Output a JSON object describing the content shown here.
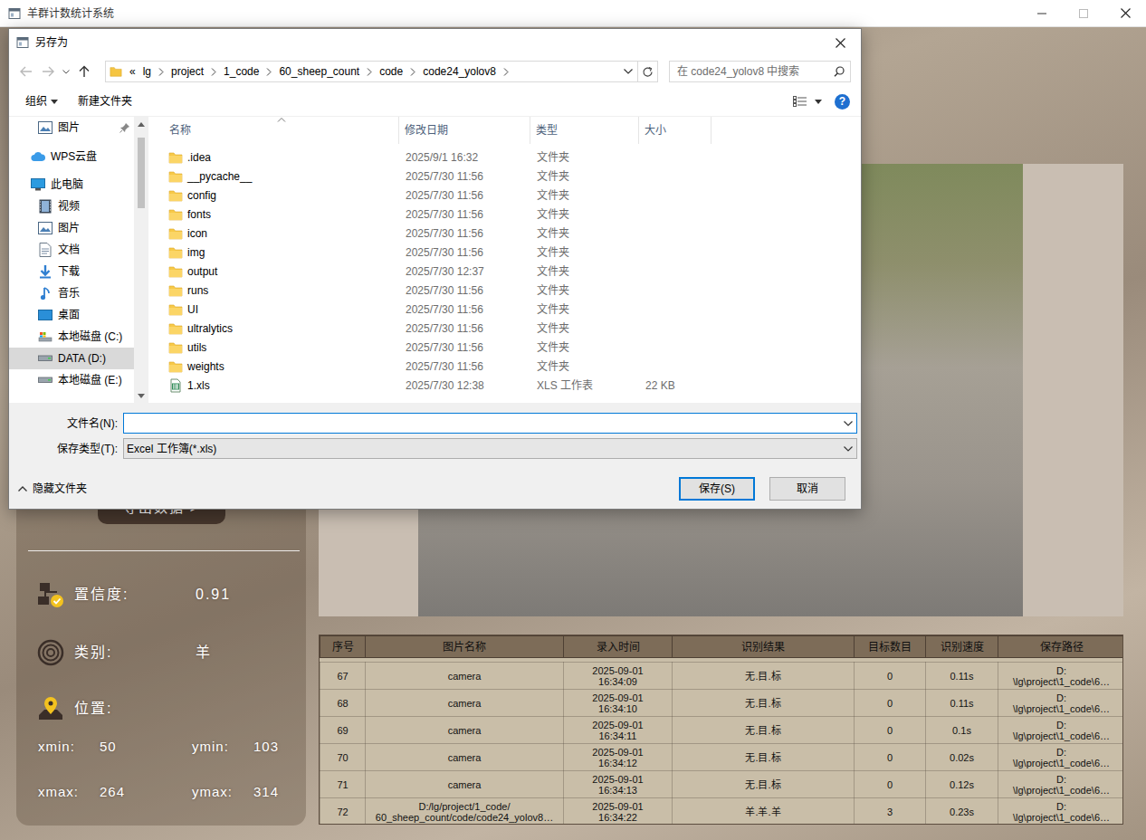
{
  "window": {
    "title": "羊群计数统计系统"
  },
  "side_panel": {
    "export_button": "导出数据 >",
    "confidence": {
      "label": "置信度:",
      "value": "0.91"
    },
    "category": {
      "label": "类别:",
      "value": "羊"
    },
    "position": {
      "label": "位置:",
      "coords": [
        {
          "label": "xmin:",
          "value": "50"
        },
        {
          "label": "ymin:",
          "value": "103"
        },
        {
          "label": "xmax:",
          "value": "264"
        },
        {
          "label": "ymax:",
          "value": "314"
        }
      ]
    }
  },
  "table": {
    "columns": [
      "序号",
      "图片名称",
      "录入时间",
      "识别结果",
      "目标数目",
      "识别速度",
      "保存路径"
    ],
    "rows": [
      [
        "67",
        "camera",
        "2025-09-01\n16:34:09",
        "无.目.标",
        "0",
        "0.11s",
        "D:\n\\lg\\project\\1_code\\6…"
      ],
      [
        "68",
        "camera",
        "2025-09-01\n16:34:10",
        "无.目.标",
        "0",
        "0.11s",
        "D:\n\\lg\\project\\1_code\\6…"
      ],
      [
        "69",
        "camera",
        "2025-09-01\n16:34:11",
        "无.目.标",
        "0",
        "0.1s",
        "D:\n\\lg\\project\\1_code\\6…"
      ],
      [
        "70",
        "camera",
        "2025-09-01\n16:34:12",
        "无.目.标",
        "0",
        "0.02s",
        "D:\n\\lg\\project\\1_code\\6…"
      ],
      [
        "71",
        "camera",
        "2025-09-01\n16:34:13",
        "无.目.标",
        "0",
        "0.12s",
        "D:\n\\lg\\project\\1_code\\6…"
      ],
      [
        "72",
        "D:/lg/project/1_code/\n60_sheep_count/code/code24_yolov8…",
        "2025-09-01\n16:34:22",
        "羊.羊.羊",
        "3",
        "0.23s",
        "D:\n\\lg\\project\\1_code\\6…"
      ]
    ]
  },
  "dialog": {
    "title": "另存为",
    "breadcrumb": {
      "overflow": "«",
      "parts": [
        "lg",
        "project",
        "1_code",
        "60_sheep_count",
        "code",
        "code24_yolov8"
      ]
    },
    "search": {
      "placeholder": "在 code24_yolov8 中搜索"
    },
    "toolbar": {
      "organize": "组织",
      "new_folder": "新建文件夹",
      "help": "?"
    },
    "nav": [
      {
        "label": "图片",
        "kind": "pictures",
        "pinned": true,
        "selected": false
      },
      {
        "label": "WPS云盘",
        "kind": "cloud",
        "pinned": false,
        "selected": false
      },
      {
        "label": "此电脑",
        "kind": "computer",
        "pinned": false,
        "selected": false
      },
      {
        "label": "视频",
        "kind": "videos",
        "pinned": false,
        "selected": false
      },
      {
        "label": "图片",
        "kind": "pictures",
        "pinned": false,
        "selected": false
      },
      {
        "label": "文档",
        "kind": "documents",
        "pinned": false,
        "selected": false
      },
      {
        "label": "下载",
        "kind": "downloads",
        "pinned": false,
        "selected": false
      },
      {
        "label": "音乐",
        "kind": "music",
        "pinned": false,
        "selected": false
      },
      {
        "label": "桌面",
        "kind": "desktop",
        "pinned": false,
        "selected": false
      },
      {
        "label": "本地磁盘 (C:)",
        "kind": "system-drive",
        "pinned": false,
        "selected": false
      },
      {
        "label": "DATA (D:)",
        "kind": "drive",
        "pinned": false,
        "selected": true
      },
      {
        "label": "本地磁盘 (E:)",
        "kind": "drive",
        "pinned": false,
        "selected": false
      }
    ],
    "columns": [
      "名称",
      "修改日期",
      "类型",
      "大小"
    ],
    "files": [
      {
        "name": ".idea",
        "date": "2025/9/1 16:32",
        "type": "文件夹",
        "size": "",
        "kind": "folder"
      },
      {
        "name": "__pycache__",
        "date": "2025/7/30 11:56",
        "type": "文件夹",
        "size": "",
        "kind": "folder"
      },
      {
        "name": "config",
        "date": "2025/7/30 11:56",
        "type": "文件夹",
        "size": "",
        "kind": "folder"
      },
      {
        "name": "fonts",
        "date": "2025/7/30 11:56",
        "type": "文件夹",
        "size": "",
        "kind": "folder"
      },
      {
        "name": "icon",
        "date": "2025/7/30 11:56",
        "type": "文件夹",
        "size": "",
        "kind": "folder"
      },
      {
        "name": "img",
        "date": "2025/7/30 11:56",
        "type": "文件夹",
        "size": "",
        "kind": "folder"
      },
      {
        "name": "output",
        "date": "2025/7/30 12:37",
        "type": "文件夹",
        "size": "",
        "kind": "folder"
      },
      {
        "name": "runs",
        "date": "2025/7/30 11:56",
        "type": "文件夹",
        "size": "",
        "kind": "folder"
      },
      {
        "name": "UI",
        "date": "2025/7/30 11:56",
        "type": "文件夹",
        "size": "",
        "kind": "folder"
      },
      {
        "name": "ultralytics",
        "date": "2025/7/30 11:56",
        "type": "文件夹",
        "size": "",
        "kind": "folder"
      },
      {
        "name": "utils",
        "date": "2025/7/30 11:56",
        "type": "文件夹",
        "size": "",
        "kind": "folder"
      },
      {
        "name": "weights",
        "date": "2025/7/30 11:56",
        "type": "文件夹",
        "size": "",
        "kind": "folder"
      },
      {
        "name": "1.xls",
        "date": "2025/7/30 12:38",
        "type": "XLS 工作表",
        "size": "22 KB",
        "kind": "spreadsheet"
      }
    ],
    "filename": {
      "label": "文件名(N):",
      "value": "",
      "focused": true
    },
    "filetype": {
      "label": "保存类型(T):",
      "value": "Excel 工作簿(*.xls)"
    },
    "hide_folders": "隐藏文件夹",
    "buttons": [
      {
        "label": "保存(S)",
        "default": true
      },
      {
        "label": "取消",
        "default": false
      }
    ]
  }
}
